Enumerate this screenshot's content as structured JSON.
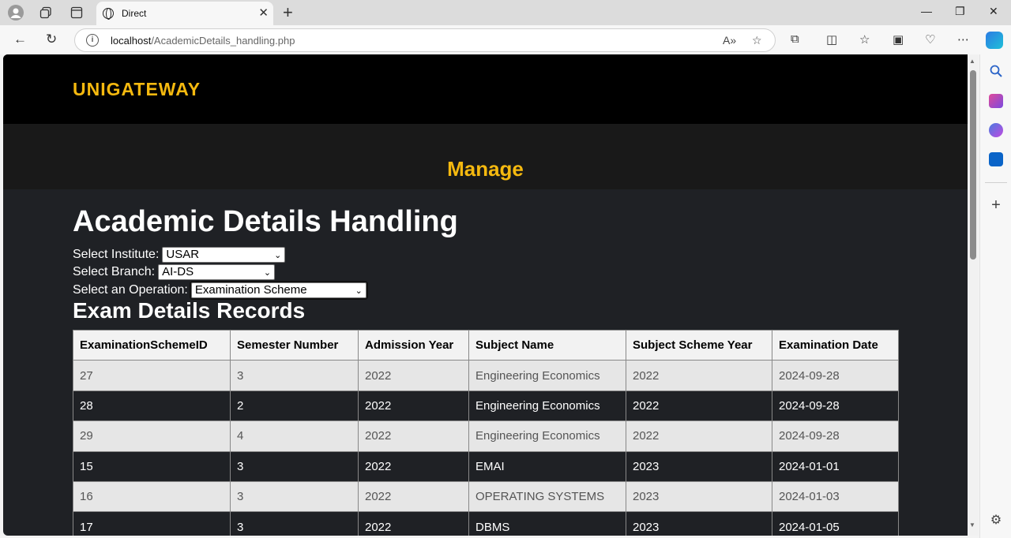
{
  "browser": {
    "tab_title": "Direct",
    "url_host": "localhost",
    "url_path": "/AcademicDetails_handling.php"
  },
  "page": {
    "brand": "UNIGATEWAY",
    "banner_title": "Manage",
    "heading": "Academic Details Handling",
    "institute_label": "Select Institute:",
    "institute_value": "USAR",
    "branch_label": "Select Branch:",
    "branch_value": "AI-DS",
    "operation_label": "Select an Operation:",
    "operation_value": "Examination Scheme",
    "records_title": "Exam Details Records"
  },
  "table": {
    "headers": [
      "ExaminationSchemeID",
      "Semester Number",
      "Admission Year",
      "Subject Name",
      "Subject Scheme Year",
      "Examination Date"
    ],
    "rows": [
      [
        "27",
        "3",
        "2022",
        "Engineering Economics",
        "2022",
        "2024-09-28"
      ],
      [
        "28",
        "2",
        "2022",
        "Engineering Economics",
        "2022",
        "2024-09-28"
      ],
      [
        "29",
        "4",
        "2022",
        "Engineering Economics",
        "2022",
        "2024-09-28"
      ],
      [
        "15",
        "3",
        "2022",
        "EMAI",
        "2023",
        "2024-01-01"
      ],
      [
        "16",
        "3",
        "2022",
        "OPERATING SYSTEMS",
        "2023",
        "2024-01-03"
      ],
      [
        "17",
        "3",
        "2022",
        "DBMS",
        "2023",
        "2024-01-05"
      ]
    ]
  }
}
